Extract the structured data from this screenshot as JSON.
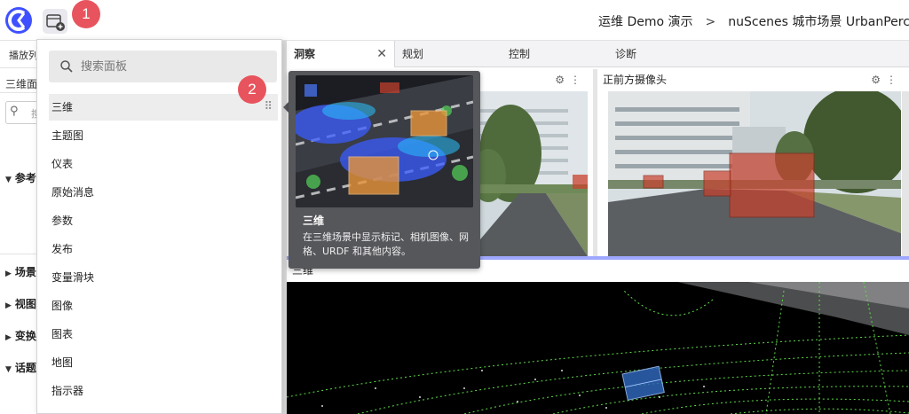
{
  "topbar": {
    "breadcrumb": [
      "运维 Demo 演示",
      "nuScenes 城市场景 UrbanPercept"
    ],
    "breadcrumb_sep": ">"
  },
  "badges": [
    "1",
    "2"
  ],
  "sidebar": {
    "top_label": "播放列",
    "panel_label": "三维面",
    "search_partial": "搜",
    "sections": [
      "参考",
      "场景",
      "视图",
      "变换",
      "话题"
    ]
  },
  "menu": {
    "search_placeholder": "搜索面板",
    "items": [
      "三维",
      "主题图",
      "仪表",
      "原始消息",
      "参数",
      "发布",
      "变量滑块",
      "图像",
      "图表",
      "地图",
      "指示器"
    ]
  },
  "tooltip": {
    "title": "三维",
    "description": "在三维场景中显示标记、相机图像、网格、URDF 和其他内容。"
  },
  "tabs": [
    {
      "label": "洞察",
      "active": true
    },
    {
      "label": "规划"
    },
    {
      "label": "控制"
    },
    {
      "label": "诊断"
    }
  ],
  "panels": {
    "front_camera_title": "正前方摄像头",
    "scene3d_title": "三维"
  },
  "colors": {
    "accent": "#3f51ff",
    "badge": "#e8545d",
    "tooltip_bg": "#56575b",
    "box_red": "#c9412d",
    "box_orange": "#e8943a",
    "lidar_green": "#5fdc4a"
  },
  "icons": {
    "search": "search-icon",
    "gear": "gear-icon",
    "more": "more-vertical-icon",
    "close": "close-icon",
    "drag": "drag-handle-icon",
    "add_panel": "add-panel-icon",
    "logo": "app-logo"
  }
}
